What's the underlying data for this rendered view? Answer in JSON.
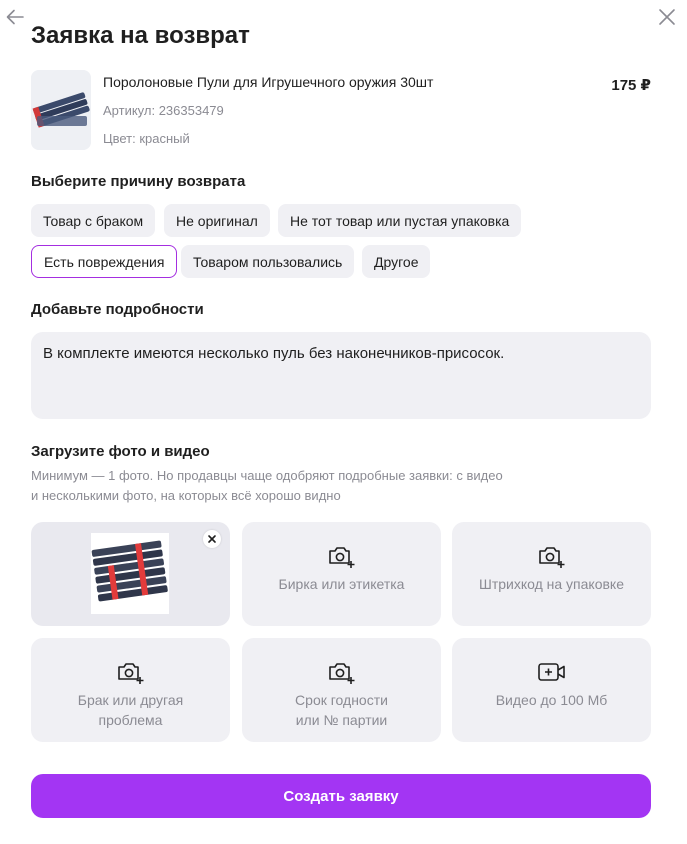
{
  "dialog": {
    "title": "Заявка на возврат"
  },
  "product": {
    "name": "Поролоновые Пули для Игрушечного оружия 30шт",
    "sku": "Артикул: 236353479",
    "color": "Цвет: красный",
    "price": "175 ₽"
  },
  "reason": {
    "heading": "Выберите причину возврата",
    "options": [
      {
        "label": "Товар с браком",
        "selected": false
      },
      {
        "label": "Не оригинал",
        "selected": false
      },
      {
        "label": "Не тот товар или пустая упаковка",
        "selected": false
      },
      {
        "label": "Есть повреждения",
        "selected": true
      },
      {
        "label": "Товаром пользовались",
        "selected": false
      },
      {
        "label": "Другое",
        "selected": false
      }
    ]
  },
  "details": {
    "heading": "Добавьте подробности",
    "value": "В комплекте имеются несколько пуль без наконечников-присосок."
  },
  "upload": {
    "heading": "Загрузите фото и видео",
    "hint_line1": "Минимум — 1 фото. Но продавцы чаще одобряют подробные заявки: с видео",
    "hint_line2": "и несколькими фото, на которых всё хорошо видно",
    "slots": [
      {
        "label": "Бирка или этикетка",
        "icon": "camera-plus-icon"
      },
      {
        "label": "Штрихкод на упаковке",
        "icon": "camera-plus-icon"
      },
      {
        "label_line1": "Брак или другая",
        "label_line2": "проблема",
        "icon": "camera-plus-icon"
      },
      {
        "label_line1": "Срок годности",
        "label_line2": "или № партии",
        "icon": "camera-plus-icon"
      },
      {
        "label": "Видео до 100 Мб",
        "icon": "video-plus-icon"
      }
    ]
  },
  "actions": {
    "submit_label": "Создать заявку"
  },
  "colors": {
    "accent": "#a335f3",
    "chip_bg": "#f0f0f4",
    "selected_border": "#a42ee0",
    "muted_text": "#8b8b93"
  }
}
